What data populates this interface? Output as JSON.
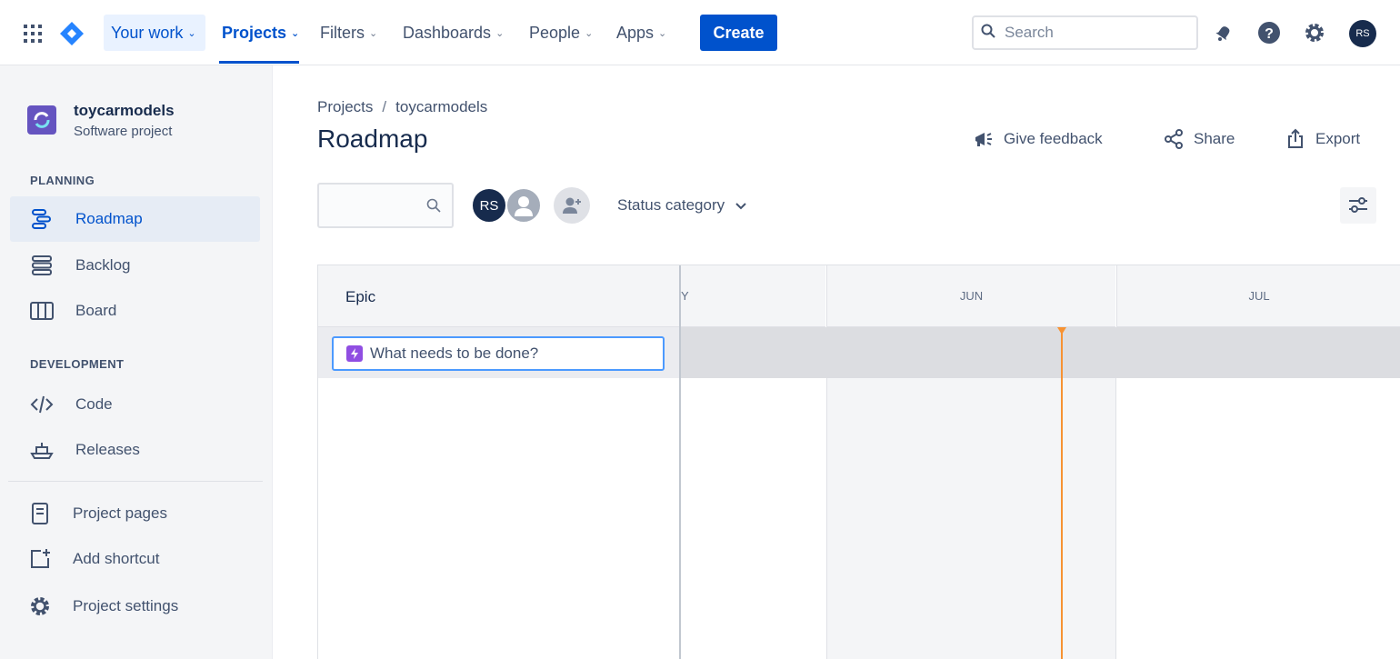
{
  "nav": {
    "items": [
      {
        "label": "Your work"
      },
      {
        "label": "Projects"
      },
      {
        "label": "Filters"
      },
      {
        "label": "Dashboards"
      },
      {
        "label": "People"
      },
      {
        "label": "Apps"
      }
    ],
    "create_label": "Create",
    "search_placeholder": "Search",
    "user_initials": "RS",
    "icons": [
      "app-switcher-icon",
      "jira-logo-icon",
      "notifications-icon",
      "help-icon",
      "settings-icon"
    ]
  },
  "sidebar": {
    "project_name": "toycarmodels",
    "project_type": "Software project",
    "planning_heading": "PLANNING",
    "development_heading": "DEVELOPMENT",
    "items": [
      {
        "label": "Roadmap",
        "icon": "roadmap-icon",
        "active": true
      },
      {
        "label": "Backlog",
        "icon": "backlog-icon"
      },
      {
        "label": "Board",
        "icon": "board-icon"
      },
      {
        "label": "Code",
        "icon": "code-icon"
      },
      {
        "label": "Releases",
        "icon": "releases-icon"
      },
      {
        "label": "Project pages",
        "icon": "pages-icon"
      },
      {
        "label": "Add shortcut",
        "icon": "add-shortcut-icon"
      },
      {
        "label": "Project settings",
        "icon": "settings-icon"
      }
    ]
  },
  "main": {
    "breadcrumb": [
      "Projects",
      "toycarmodels"
    ],
    "breadcrumb_sep": "/",
    "title": "Roadmap",
    "actions": {
      "feedback": "Give feedback",
      "share": "Share",
      "export": "Export"
    },
    "filters": {
      "avatar_initials": "RS",
      "status_category": "Status category"
    }
  },
  "roadmap": {
    "epic_header": "Epic",
    "months": [
      "Y",
      "JUN",
      "JUL"
    ],
    "epic_input_placeholder": "What needs to be done?",
    "colors": {
      "accent": "#0052cc",
      "today": "#f79232",
      "epic": "#904ee2"
    }
  }
}
